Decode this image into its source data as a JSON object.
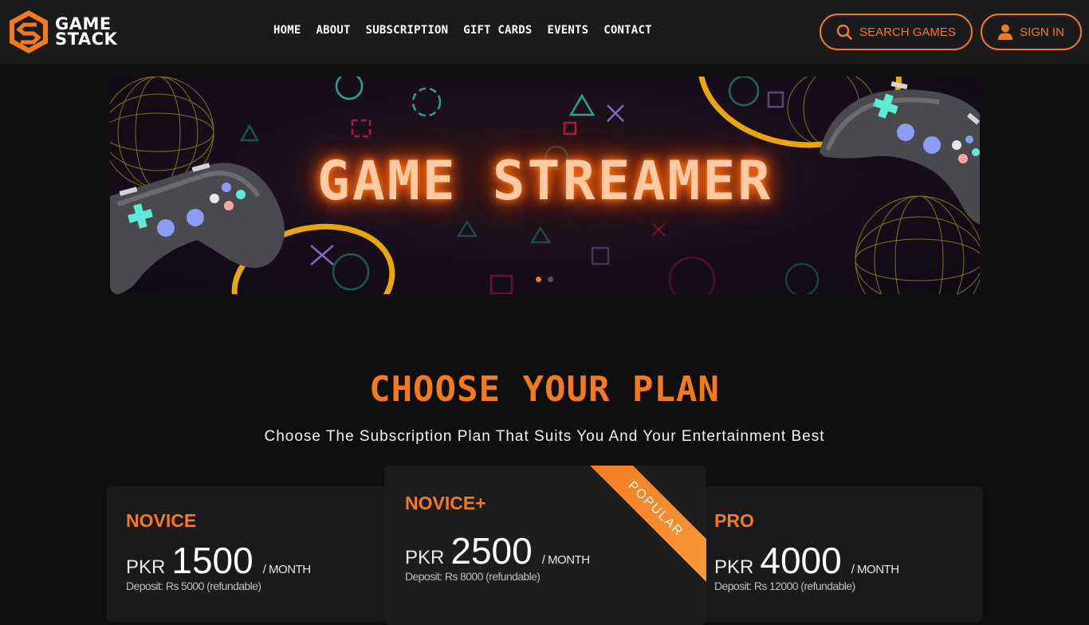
{
  "brand": {
    "line1": "GAME",
    "line2": "STACK"
  },
  "nav": {
    "items": [
      "HOME",
      "ABOUT",
      "SUBSCRIPTION",
      "GIFT CARDS",
      "EVENTS",
      "CONTACT"
    ]
  },
  "header": {
    "search_label": "SEARCH GAMES",
    "signin_label": "SIGN IN"
  },
  "banner": {
    "title": "GAME STREAMER",
    "slide_count": 2,
    "active_slide": 1
  },
  "plans": {
    "title": "CHOOSE YOUR PLAN",
    "subtitle": "Choose The Subscription Plan That Suits You And Your Entertainment Best",
    "items": [
      {
        "name": "NOVICE",
        "currency": "PKR",
        "price": "1500",
        "period": "/ MONTH",
        "deposit": "Deposit: Rs 5000 (refundable)"
      },
      {
        "name": "NOVICE+",
        "currency": "PKR",
        "price": "2500",
        "period": "/ MONTH",
        "deposit": "Deposit: Rs 8000 (refundable)",
        "badge": "POPULAR"
      },
      {
        "name": "PRO",
        "currency": "PKR",
        "price": "4000",
        "period": "/ MONTH",
        "deposit": "Deposit: Rs 12000 (refundable)"
      }
    ]
  },
  "colors": {
    "accent": "#f47a20",
    "background": "#0f0f0f",
    "header": "#1b1b1b",
    "card": "#1a1a1a"
  },
  "icons": [
    "game-stack-logo-icon",
    "search-icon",
    "user-icon",
    "gamepad-icon"
  ]
}
